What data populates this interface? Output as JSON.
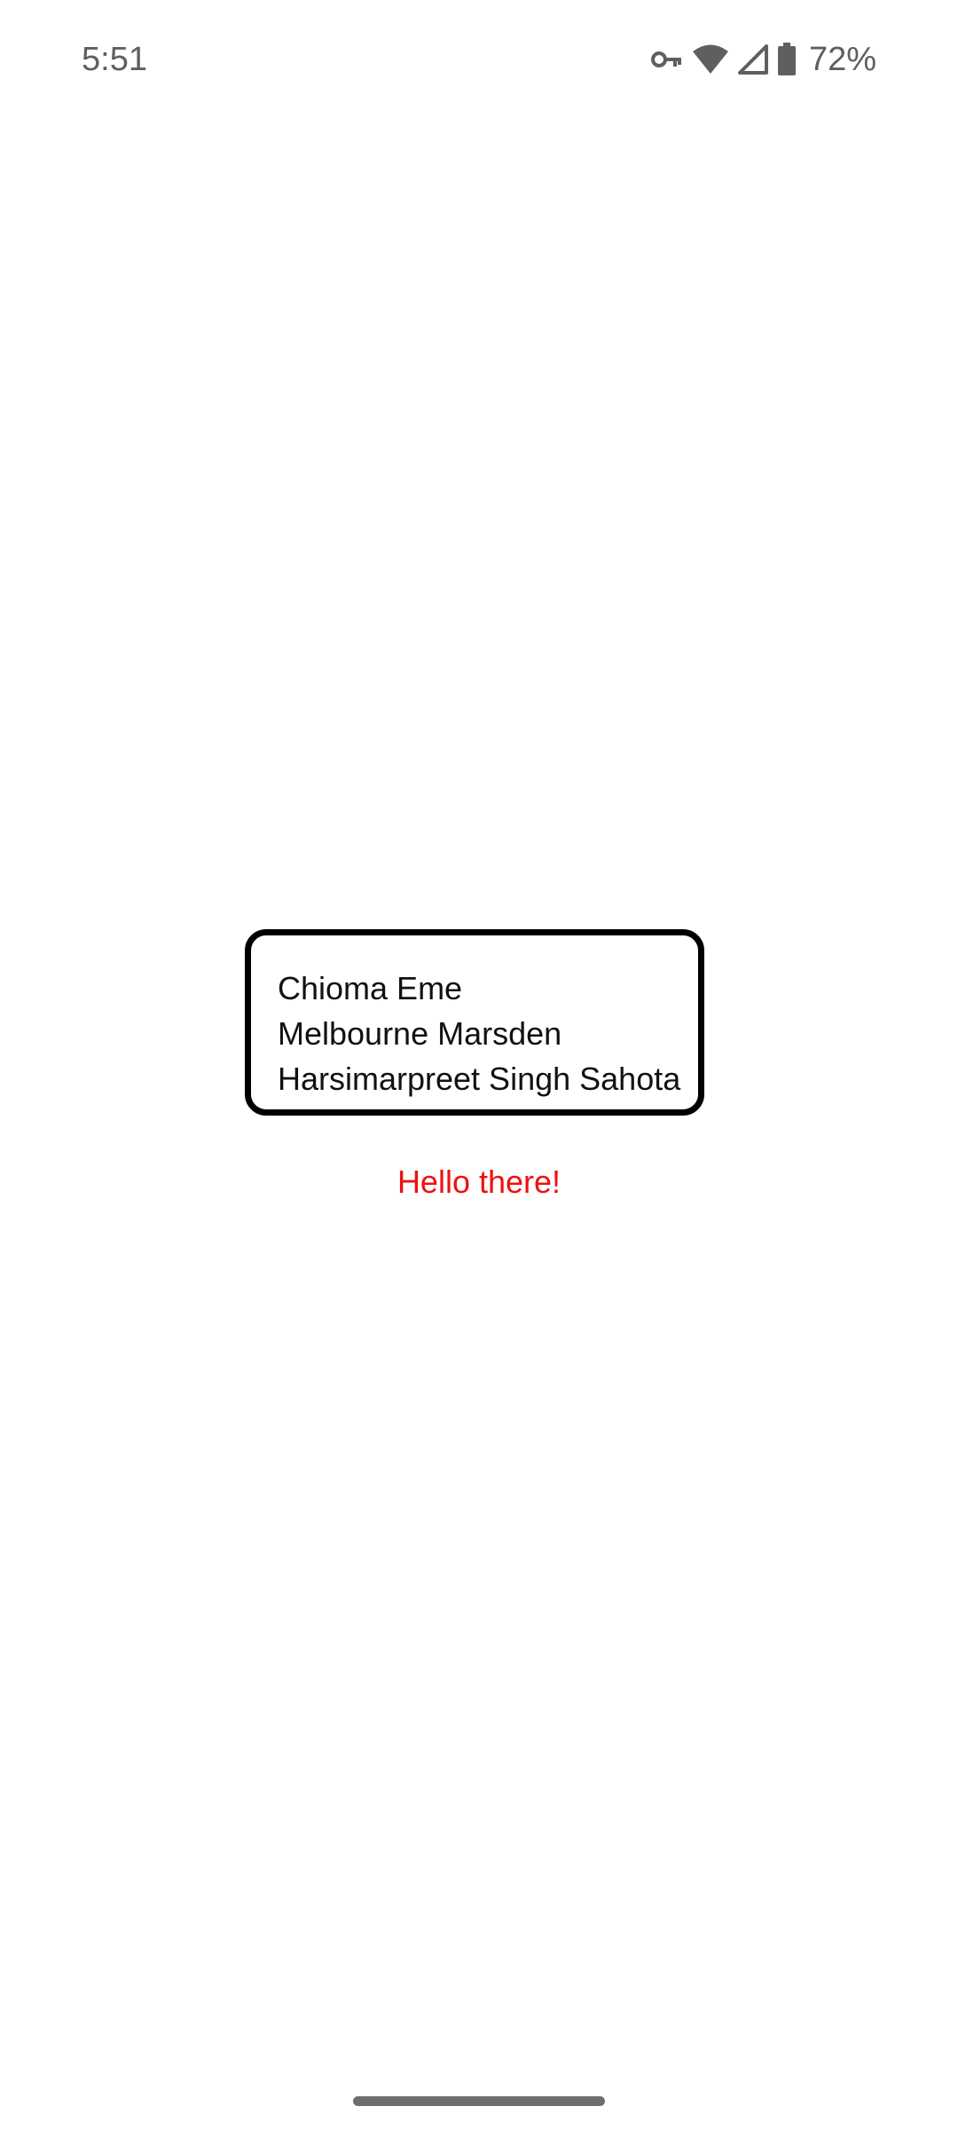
{
  "status_bar": {
    "time": "5:51",
    "battery_percent": "72%",
    "icons": [
      "vpn-key-icon",
      "wifi-icon",
      "cellular-signal-icon",
      "battery-icon"
    ]
  },
  "names_card": {
    "names": [
      "Chioma Eme",
      "Melbourne Marsden",
      "Harsimarpreet Singh Sahota"
    ]
  },
  "greeting": "Hello there!",
  "colors": {
    "greeting": "#ee1111",
    "card_border": "#000000",
    "status_text": "#5f5f5f"
  }
}
